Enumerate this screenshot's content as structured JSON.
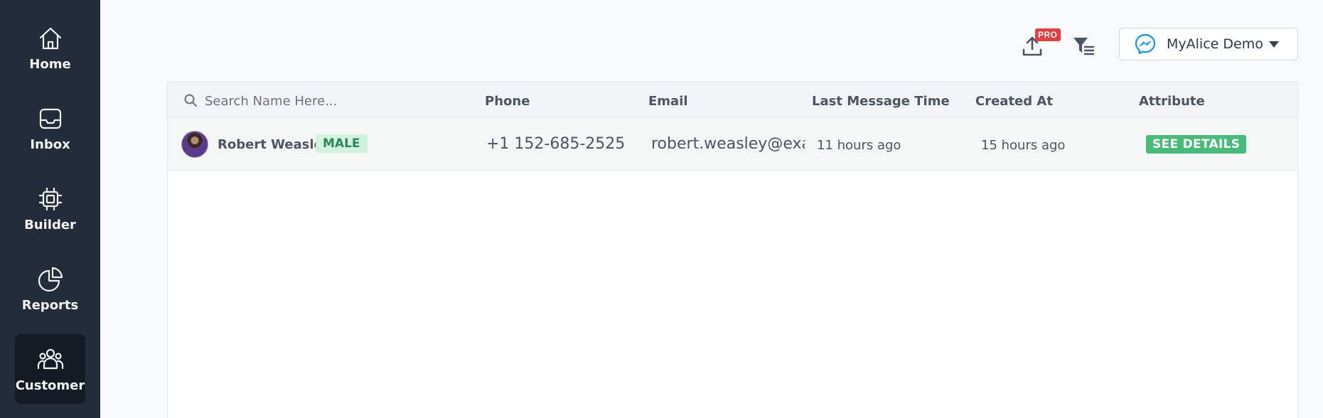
{
  "sidebar": {
    "items": [
      {
        "label": "Home",
        "icon": "home-icon"
      },
      {
        "label": "Inbox",
        "icon": "inbox-icon"
      },
      {
        "label": "Builder",
        "icon": "chip-icon"
      },
      {
        "label": "Reports",
        "icon": "pie-chart-icon"
      },
      {
        "label": "Customer",
        "icon": "users-icon",
        "active": true
      }
    ]
  },
  "topbar": {
    "pro_badge": "PRO",
    "export_icon": "upload-icon",
    "filter_icon": "filter-list-icon",
    "channel_icon": "messenger-icon",
    "channel_name": "MyAlice Demo"
  },
  "table": {
    "search_placeholder": "Search Name Here...",
    "columns": [
      "Phone",
      "Email",
      "Last Message Time",
      "Created At",
      "Attribute"
    ],
    "rows": [
      {
        "name": "Robert Weasley",
        "gender": "MALE",
        "phone": "+1 152-685-2525",
        "email": "robert.weasley@example.com",
        "last_message_time": "11 hours ago",
        "created_at": "15 hours ago",
        "attribute_action": "SEE DETAILS"
      }
    ]
  },
  "colors": {
    "sidebar_bg": "#232c3a",
    "sidebar_active": "#141b25",
    "pro_badge": "#e53e3e",
    "see_details": "#48bb78",
    "gender_badge_bg": "#d1f2df",
    "messenger_blue": "#1d9bf0"
  }
}
